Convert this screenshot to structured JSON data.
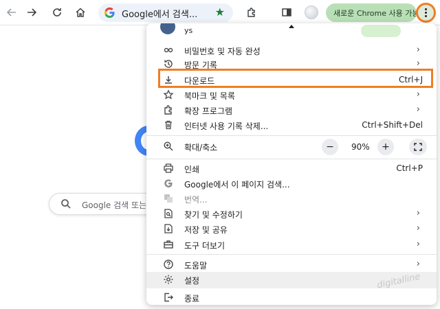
{
  "toolbar": {
    "omnibox_text": "Google에서 검색...",
    "update_label": "새로운 Chrome 사용 가능"
  },
  "page": {
    "search_placeholder": "Google 검색 또는"
  },
  "menu": {
    "top_partial_name": "ys",
    "items": [
      {
        "label": "비밀번호 및 자동 완성",
        "icon": "key-icon",
        "submenu": true
      },
      {
        "label": "방문 기록",
        "icon": "history-icon",
        "submenu": true
      },
      {
        "label": "다운로드",
        "icon": "download-icon",
        "shortcut": "Ctrl+J"
      },
      {
        "label": "북마크 및 목록",
        "icon": "star-icon",
        "submenu": true
      },
      {
        "label": "확장 프로그램",
        "icon": "extension-icon",
        "submenu": true
      },
      {
        "label": "인터넷 사용 기록 삭제...",
        "icon": "trash-icon",
        "shortcut": "Ctrl+Shift+Del"
      },
      {
        "label": "확대/축소",
        "icon": "zoom-icon"
      },
      {
        "label": "인쇄",
        "icon": "print-icon",
        "shortcut": "Ctrl+P"
      },
      {
        "label": "Google에서 이 페이지 검색...",
        "icon": "google-icon"
      },
      {
        "label": "번역...",
        "icon": "translate-icon"
      },
      {
        "label": "찾기 및 수정하기",
        "icon": "find-icon",
        "submenu": true
      },
      {
        "label": "저장 및 공유",
        "icon": "save-share-icon",
        "submenu": true
      },
      {
        "label": "도구 더보기",
        "icon": "toolbox-icon",
        "submenu": true
      },
      {
        "label": "도움말",
        "icon": "help-icon",
        "submenu": true
      },
      {
        "label": "설정",
        "icon": "gear-icon"
      },
      {
        "label": "종료",
        "icon": "exit-icon"
      }
    ],
    "zoom": {
      "minus": "−",
      "value": "90%",
      "plus": "+"
    },
    "chevron": "›"
  },
  "watermark": "digitalline",
  "colors": {
    "accent_outline": "#ef7d22",
    "update_pill": "#b9dfb7"
  }
}
